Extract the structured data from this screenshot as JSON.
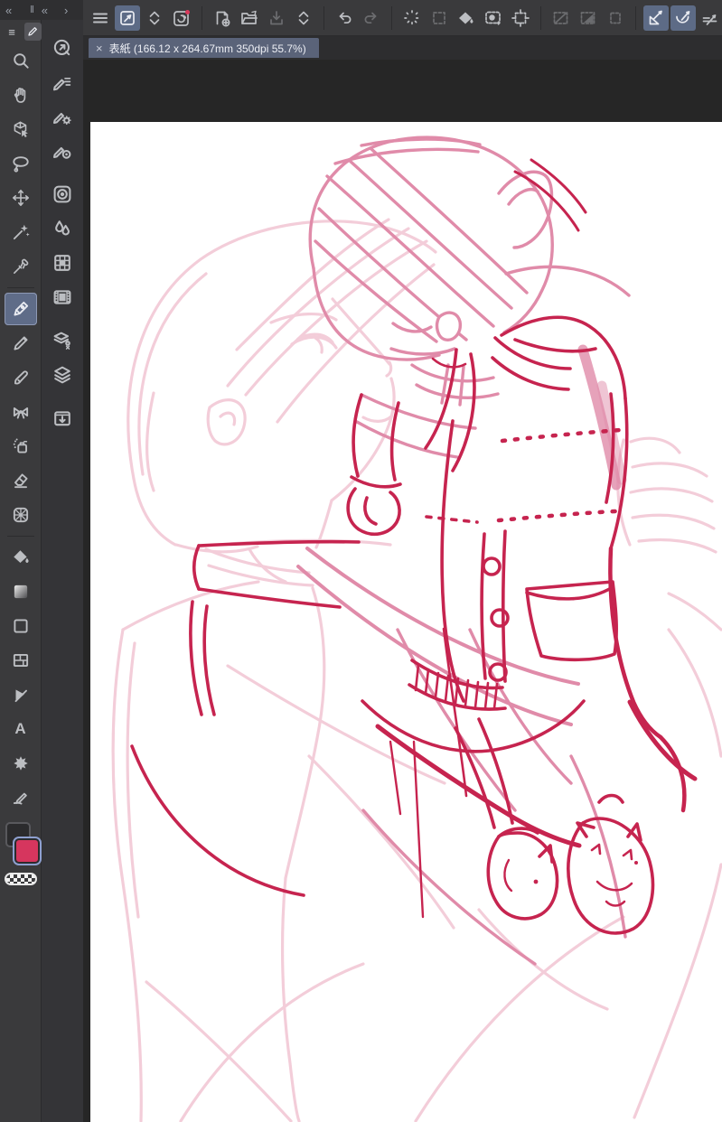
{
  "window": {
    "dock_controls": {
      "items": [
        {
          "name": "collapse-dock-left-icon",
          "glyph": "«"
        },
        {
          "name": "dock-divider-glyph",
          "glyph": "‖"
        },
        {
          "name": "collapse-dock-icon",
          "glyph": "«"
        },
        {
          "name": "expand-dock-icon",
          "glyph": "›"
        }
      ]
    }
  },
  "command_bar": {
    "items": [
      {
        "name": "main-menu",
        "state": "normal"
      },
      {
        "name": "operation-tool-toggle",
        "state": "active"
      },
      {
        "name": "tool-switch-chevrons",
        "state": "normal"
      },
      {
        "name": "clip-studio-logo",
        "state": "normal",
        "badge_color": "#d93a5c"
      },
      {
        "name": "new-document",
        "state": "normal"
      },
      {
        "name": "open-file",
        "state": "normal"
      },
      {
        "name": "save",
        "state": "disabled"
      },
      {
        "name": "save-chevrons",
        "state": "normal"
      },
      {
        "name": "undo",
        "state": "normal"
      },
      {
        "name": "redo",
        "state": "disabled"
      },
      {
        "name": "deselect",
        "state": "normal"
      },
      {
        "name": "reselect",
        "state": "disabled"
      },
      {
        "name": "fill",
        "state": "normal"
      },
      {
        "name": "paste-material",
        "state": "normal"
      },
      {
        "name": "change-canvas-size",
        "state": "normal"
      },
      {
        "name": "selection-launcher-line",
        "state": "disabled"
      },
      {
        "name": "selection-launcher-area",
        "state": "disabled"
      },
      {
        "name": "selection-launcher-plain",
        "state": "disabled"
      },
      {
        "name": "snap-to-ruler",
        "state": "active"
      },
      {
        "name": "snap-to-special-ruler",
        "state": "active"
      },
      {
        "name": "snap-to-grid",
        "state": "normal"
      }
    ],
    "active_bg": "#5d6b86"
  },
  "document_tab": {
    "close_glyph": "×",
    "title": "表紙 (166.12 x 264.67mm 350dpi 55.7%)",
    "document_name": "表紙",
    "width_mm": "166.12",
    "height_mm": "264.67",
    "dpi": "350",
    "zoom_percent": "55.7%"
  },
  "tool_palette": {
    "menu_glyph": "≡",
    "text_glyph": "A",
    "tools": [
      {
        "name": "zoom-tool",
        "selected": false
      },
      {
        "name": "hand-tool",
        "selected": false
      },
      {
        "name": "object-tool",
        "selected": false
      },
      {
        "name": "lasso-select-tool",
        "selected": false
      },
      {
        "name": "move-layer-tool",
        "selected": false
      },
      {
        "name": "auto-select-tool",
        "selected": false
      },
      {
        "name": "eyedropper-tool",
        "selected": false
      },
      {
        "name": "pen-tool",
        "selected": true
      },
      {
        "name": "pencil-tool",
        "selected": false
      },
      {
        "name": "brush-tool",
        "selected": false
      },
      {
        "name": "decoration-tool",
        "selected": false
      },
      {
        "name": "airbrush-tool",
        "selected": false
      },
      {
        "name": "eraser-tool",
        "selected": false
      },
      {
        "name": "blend-tool",
        "selected": false
      },
      {
        "name": "fill-tool",
        "selected": false
      },
      {
        "name": "gradient-tool",
        "selected": false
      },
      {
        "name": "figure-tool",
        "selected": false
      },
      {
        "name": "frame-border-tool",
        "selected": false
      },
      {
        "name": "ruler-tool",
        "selected": false
      },
      {
        "name": "text-tool",
        "selected": false
      },
      {
        "name": "balloon-tool",
        "selected": false
      },
      {
        "name": "correct-line-tool",
        "selected": false
      }
    ]
  },
  "color_area": {
    "main_color": "#2b2b2d",
    "sub_color": "#d6365e",
    "sub_color_selected": true,
    "transparent_swatch": "checkerboard"
  },
  "palette_bar": {
    "items": [
      "quick-access",
      "sub-tool",
      "tool-property",
      "brush-size",
      "color-wheel",
      "color-slider",
      "color-set",
      "timeline",
      "layer-property",
      "layer",
      "material"
    ]
  },
  "canvas": {
    "page_color": "#ffffff",
    "workspace_color": "#262626",
    "sketch_colors": {
      "light_pink": "#f3cdd9",
      "mid_pink": "#e08ba9",
      "deep_pink": "#c6244f"
    }
  }
}
